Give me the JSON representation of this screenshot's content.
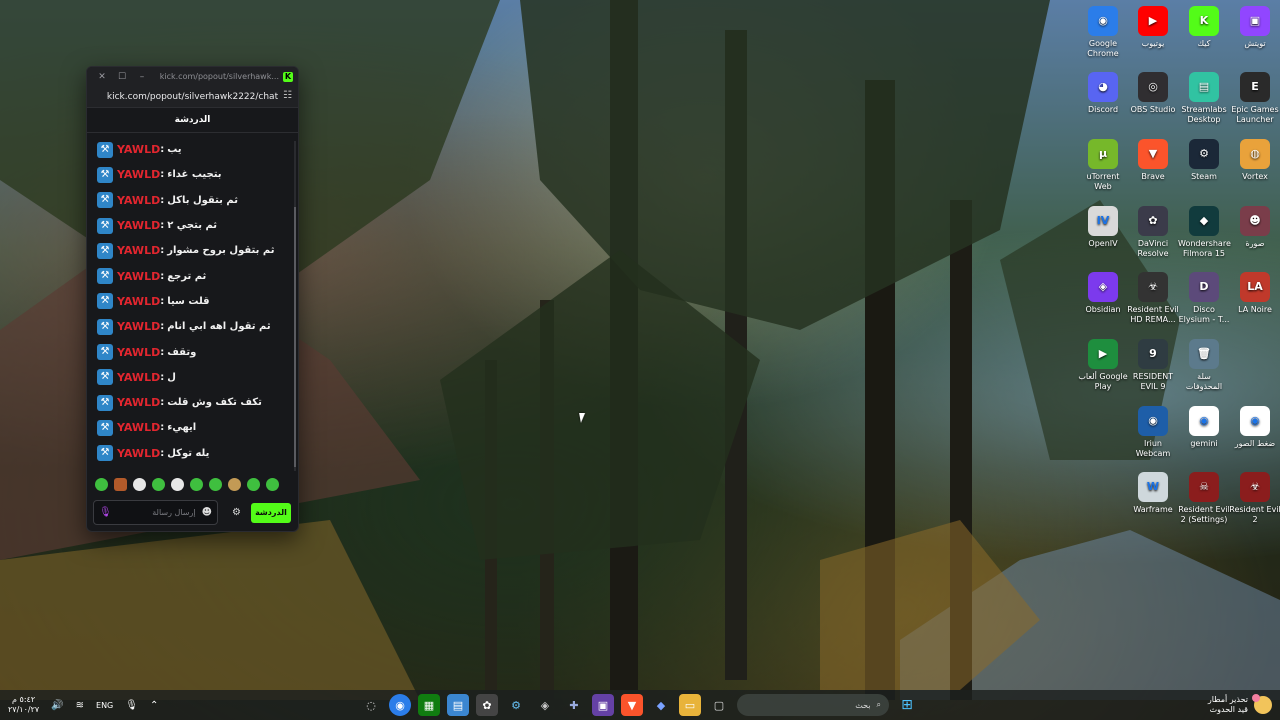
{
  "popup": {
    "title_url": "kick.com/popout/silverhawk...",
    "url": "kick.com/popout/silverhawk2222/chat",
    "header": "الدردشة",
    "messages": [
      {
        "user": "YAWLD",
        "text": "يب"
      },
      {
        "user": "YAWLD",
        "text": "بتجيب غداء"
      },
      {
        "user": "YAWLD",
        "text": "ثم بتقول باكل"
      },
      {
        "user": "YAWLD",
        "text": "ثم بتجي ٢"
      },
      {
        "user": "YAWLD",
        "text": "ثم بتقول بروح مشوار"
      },
      {
        "user": "YAWLD",
        "text": "ثم ترجع"
      },
      {
        "user": "YAWLD",
        "text": "قلت سيا"
      },
      {
        "user": "YAWLD",
        "text": "ثم تقول اهه ابي انام"
      },
      {
        "user": "YAWLD",
        "text": "وتقف"
      },
      {
        "user": "YAWLD",
        "text": "ل"
      },
      {
        "user": "YAWLD",
        "text": "تكف تكف وش قلت"
      },
      {
        "user": "YAWLD",
        "text": "ايهيء"
      },
      {
        "user": "YAWLD",
        "text": "يله توكل"
      }
    ],
    "input_placeholder": "إرسال رسالة",
    "send_label": "الدردشة"
  },
  "desktop_icons": [
    {
      "label": "Google Chrome",
      "icon": "chrome-icon",
      "color": "#2b7de9",
      "glyph": "◉"
    },
    {
      "label": "يوتيوب",
      "icon": "youtube-icon",
      "color": "#ff0000",
      "glyph": "▶"
    },
    {
      "label": "كيك",
      "icon": "kick-icon",
      "color": "#53fc18",
      "glyph": "K"
    },
    {
      "label": "تويتش",
      "icon": "twitch-icon",
      "color": "#9146ff",
      "glyph": "▣"
    },
    {
      "label": "Discord",
      "icon": "discord-icon",
      "color": "#5865f2",
      "glyph": "◕"
    },
    {
      "label": "OBS Studio",
      "icon": "obs-icon",
      "color": "#302e31",
      "glyph": "◎"
    },
    {
      "label": "Streamlabs Desktop",
      "icon": "streamlabs-icon",
      "color": "#31c3a2",
      "glyph": "▤"
    },
    {
      "label": "Epic Games Launcher",
      "icon": "epic-icon",
      "color": "#2a2a2a",
      "glyph": "E"
    },
    {
      "label": "uTorrent Web",
      "icon": "utorrent-icon",
      "color": "#76b82a",
      "glyph": "μ"
    },
    {
      "label": "Brave",
      "icon": "brave-icon",
      "color": "#fb542b",
      "glyph": "▼"
    },
    {
      "label": "Steam",
      "icon": "steam-icon",
      "color": "#1b2838",
      "glyph": "⚙"
    },
    {
      "label": "Vortex",
      "icon": "vortex-icon",
      "color": "#e9a23b",
      "glyph": "◍"
    },
    {
      "label": "OpenIV",
      "icon": "openiv-icon",
      "color": "#d9d9d9",
      "glyph": "IV"
    },
    {
      "label": "DaVinci Resolve",
      "icon": "davinci-icon",
      "color": "#3b3b4a",
      "glyph": "✿"
    },
    {
      "label": "Wondershare Filmora 15",
      "icon": "filmora-icon",
      "color": "#113b3d",
      "glyph": "◆"
    },
    {
      "label": "صورة",
      "icon": "photo-icon",
      "color": "#7a3d4a",
      "glyph": "☻"
    },
    {
      "label": "Obsidian",
      "icon": "obsidian-icon",
      "color": "#7c3aed",
      "glyph": "◈"
    },
    {
      "label": "Resident Evil HD REMA...",
      "icon": "re-hd-icon",
      "color": "#333333",
      "glyph": "☣"
    },
    {
      "label": "Disco Elysium - T...",
      "icon": "disco-icon",
      "color": "#5c4a7a",
      "glyph": "D"
    },
    {
      "label": "LA Noire",
      "icon": "lanoire-icon",
      "color": "#c0392b",
      "glyph": "LA"
    },
    {
      "label": "ألعاب Google Play",
      "icon": "googleplay-icon",
      "color": "#1e8e3e",
      "glyph": "▶"
    },
    {
      "label": "RESIDENT EVIL 9",
      "icon": "re9-icon",
      "color": "#2f3c42",
      "glyph": "9"
    },
    {
      "label": "سلة المحذوفات",
      "icon": "recycle-bin-icon",
      "color": "#5c7a8c",
      "glyph": "🗑"
    },
    {
      "label": "Iriun Webcam",
      "icon": "iriun-icon",
      "color": "#1e5ea8",
      "glyph": "◉"
    },
    {
      "label": "gemini",
      "icon": "gemini-chrome-icon",
      "color": "#ffffff",
      "glyph": "◉"
    },
    {
      "label": "ضغط الصور",
      "icon": "compress-chrome-icon",
      "color": "#ffffff",
      "glyph": "◉"
    },
    {
      "label": "Warframe",
      "icon": "warframe-icon",
      "color": "#cfd8dc",
      "glyph": "W"
    },
    {
      "label": "Resident Evil 2 (Settings)",
      "icon": "re2-settings-icon",
      "color": "#8b1d1d",
      "glyph": "☠"
    },
    {
      "label": "Resident Evil 2",
      "icon": "re2-icon",
      "color": "#8b1d1d",
      "glyph": "☣"
    }
  ],
  "taskbar": {
    "clock_time": "٥:٤٢ م",
    "clock_date": "٢٧/١٠/٢٧",
    "language": "ENG",
    "search_placeholder": "بحث",
    "weather_title": "تحذير أمطار",
    "weather_sub": "قيد الحدوث"
  }
}
